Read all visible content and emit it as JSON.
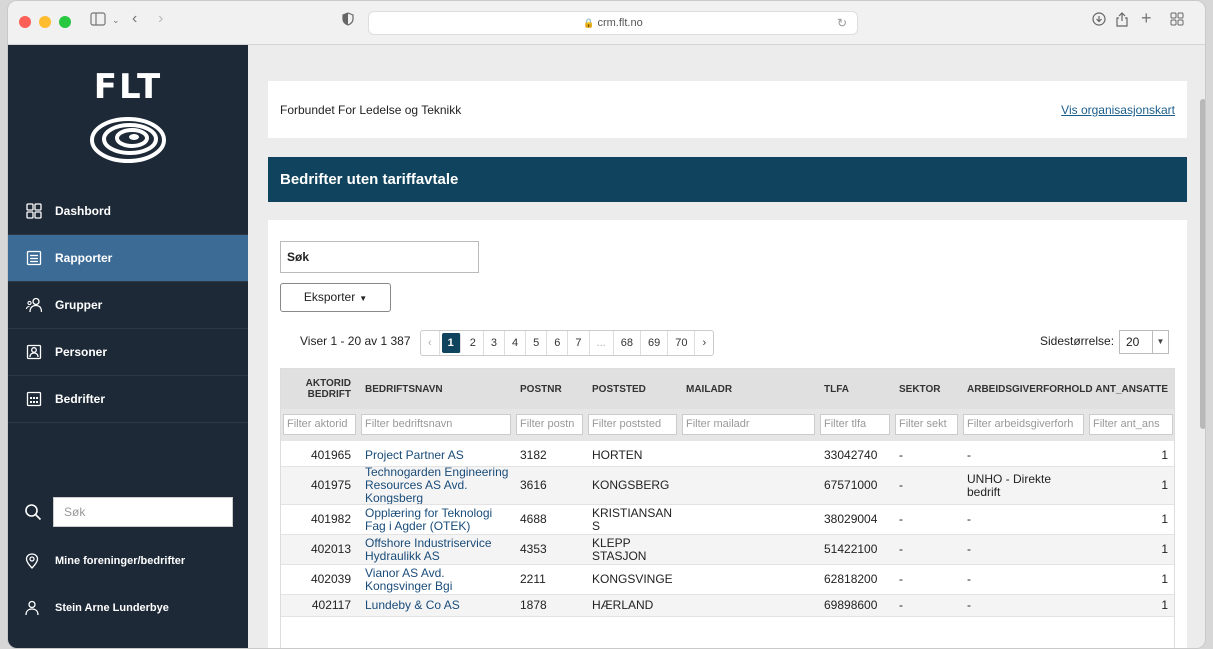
{
  "browser": {
    "url": "crm.flt.no"
  },
  "sidebar": {
    "logo": "FLT",
    "items": [
      {
        "label": "Dashbord",
        "icon": "dashboard-icon"
      },
      {
        "label": "Rapporter",
        "icon": "report-icon"
      },
      {
        "label": "Grupper",
        "icon": "group-icon"
      },
      {
        "label": "Personer",
        "icon": "person-card-icon"
      },
      {
        "label": "Bedrifter",
        "icon": "building-icon"
      }
    ],
    "search_placeholder": "Søk",
    "mine": "Mine foreninger/bedrifter",
    "user": "Stein Arne Lunderbye"
  },
  "header": {
    "org_name": "Forbundet For Ledelse og Teknikk",
    "org_link": "Vis organisasjonskart"
  },
  "report": {
    "title": "Bedrifter uten tariffavtale",
    "search_label": "Søk",
    "export_label": "Eksporter",
    "showing": "Viser 1 - 20 av 1 387",
    "pages": [
      "1",
      "2",
      "3",
      "4",
      "5",
      "6",
      "7",
      "...",
      "68",
      "69",
      "70"
    ],
    "page_size_label": "Sidestørrelse:",
    "page_size": "20"
  },
  "table": {
    "columns": [
      "AKTORID BEDRIFT",
      "BEDRIFTSNAVN",
      "POSTNR",
      "POSTSTED",
      "MAILADR",
      "TLFA",
      "SEKTOR",
      "ARBEIDSGIVERFORHOLD",
      "ANT_ANSATTE"
    ],
    "filters": [
      "Filter aktorid",
      "Filter bedriftsnavn",
      "Filter postn",
      "Filter poststed",
      "Filter mailadr",
      "Filter tlfa",
      "Filter sekt",
      "Filter arbeidsgiverforh",
      "Filter ant_ans"
    ],
    "rows": [
      [
        "401965",
        "Project Partner AS",
        "3182",
        "HORTEN",
        "",
        "33042740",
        "-",
        "-",
        "1"
      ],
      [
        "401975",
        "Technogarden Engineering Resources AS Avd. Kongsberg",
        "3616",
        "KONGSBERG",
        "",
        "67571000",
        "-",
        "UNHO - Direkte bedrift",
        "1"
      ],
      [
        "401982",
        "Opplæring for Teknologi Fag i Agder (OTEK)",
        "4688",
        "KRISTIANSAND S",
        "",
        "38029004",
        "-",
        "-",
        "1"
      ],
      [
        "402013",
        "Offshore Industriservice Hydraulikk AS",
        "4353",
        "KLEPP STASJON",
        "",
        "51422100",
        "-",
        "-",
        "1"
      ],
      [
        "402039",
        "Vianor AS Avd. Kongsvinger Bgi",
        "2211",
        "KONGSVINGER",
        "",
        "62818200",
        "-",
        "-",
        "1"
      ],
      [
        "402117",
        "Lundeby & Co AS",
        "1878",
        "HÆRLAND",
        "",
        "69898600",
        "-",
        "-",
        "1"
      ]
    ]
  }
}
